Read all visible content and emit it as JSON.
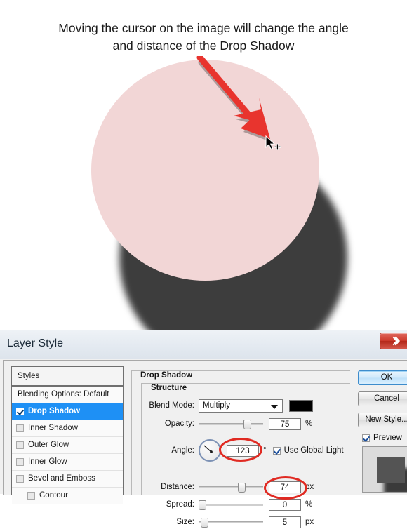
{
  "caption": {
    "line1": "Moving the cursor on the image will change the angle",
    "line2": "and distance of the Drop Shadow"
  },
  "artwork": {
    "shape": "circle",
    "shape_color": "#f2d6d6",
    "shadow_color": "#3d3d3d",
    "arrow_color": "#e8342e",
    "cursor": "move-cursor"
  },
  "dialog": {
    "title": "Layer Style",
    "close_label": "Close",
    "styles": {
      "header": "Styles",
      "items": [
        {
          "label": "Blending Options: Default",
          "checkbox": false,
          "selected": false,
          "indent": false,
          "plain": true
        },
        {
          "label": "Drop Shadow",
          "checkbox": true,
          "selected": true,
          "indent": false,
          "plain": false
        },
        {
          "label": "Inner Shadow",
          "checkbox": false,
          "selected": false,
          "indent": false,
          "plain": false
        },
        {
          "label": "Outer Glow",
          "checkbox": false,
          "selected": false,
          "indent": false,
          "plain": false
        },
        {
          "label": "Inner Glow",
          "checkbox": false,
          "selected": false,
          "indent": false,
          "plain": false
        },
        {
          "label": "Bevel and Emboss",
          "checkbox": false,
          "selected": false,
          "indent": false,
          "plain": false
        },
        {
          "label": "Contour",
          "checkbox": false,
          "selected": false,
          "indent": true,
          "plain": false
        }
      ]
    },
    "group_drop_shadow": "Drop Shadow",
    "group_structure": "Structure",
    "fields": {
      "blend_mode_label": "Blend Mode:",
      "blend_mode_value": "Multiply",
      "shadow_color_swatch": "#000000",
      "opacity_label": "Opacity:",
      "opacity_value": "75",
      "opacity_unit": "%",
      "angle_label": "Angle:",
      "angle_value": "123",
      "angle_unit": "°",
      "use_global_light": "Use Global Light",
      "use_global_light_checked": true,
      "distance_label": "Distance:",
      "distance_value": "74",
      "distance_unit": "px",
      "spread_label": "Spread:",
      "spread_value": "0",
      "spread_unit": "%",
      "size_label": "Size:",
      "size_value": "5",
      "size_unit": "px"
    },
    "buttons": {
      "ok": "OK",
      "cancel": "Cancel",
      "new_style": "New Style...",
      "preview": "Preview",
      "preview_checked": true
    },
    "accent_annotation_color": "#e02a22"
  }
}
